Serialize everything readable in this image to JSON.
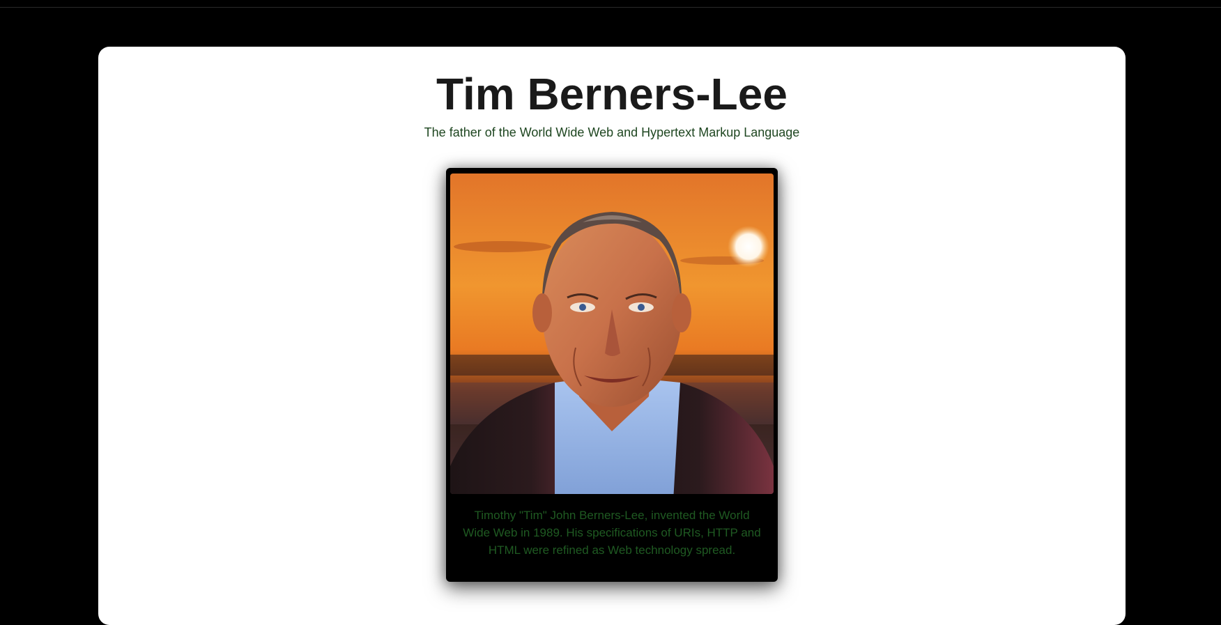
{
  "page": {
    "title": "Tim Berners-Lee",
    "subtitle": "The father of the World Wide Web and Hypertext Markup Language",
    "caption": "Timothy \"Tim\" John Berners-Lee, invented the World Wide Web in 1989. His specifications of URIs, HTTP and HTML were refined as Web technology spread."
  },
  "colors": {
    "background": "#000000",
    "card": "#ffffff",
    "title": "#1a1a1a",
    "subtitle": "#1e4620",
    "caption": "#1f5a22"
  },
  "image": {
    "subject": "portrait-painting",
    "scene": "man in blue shirt and maroon jacket before an orange sunset over water"
  }
}
